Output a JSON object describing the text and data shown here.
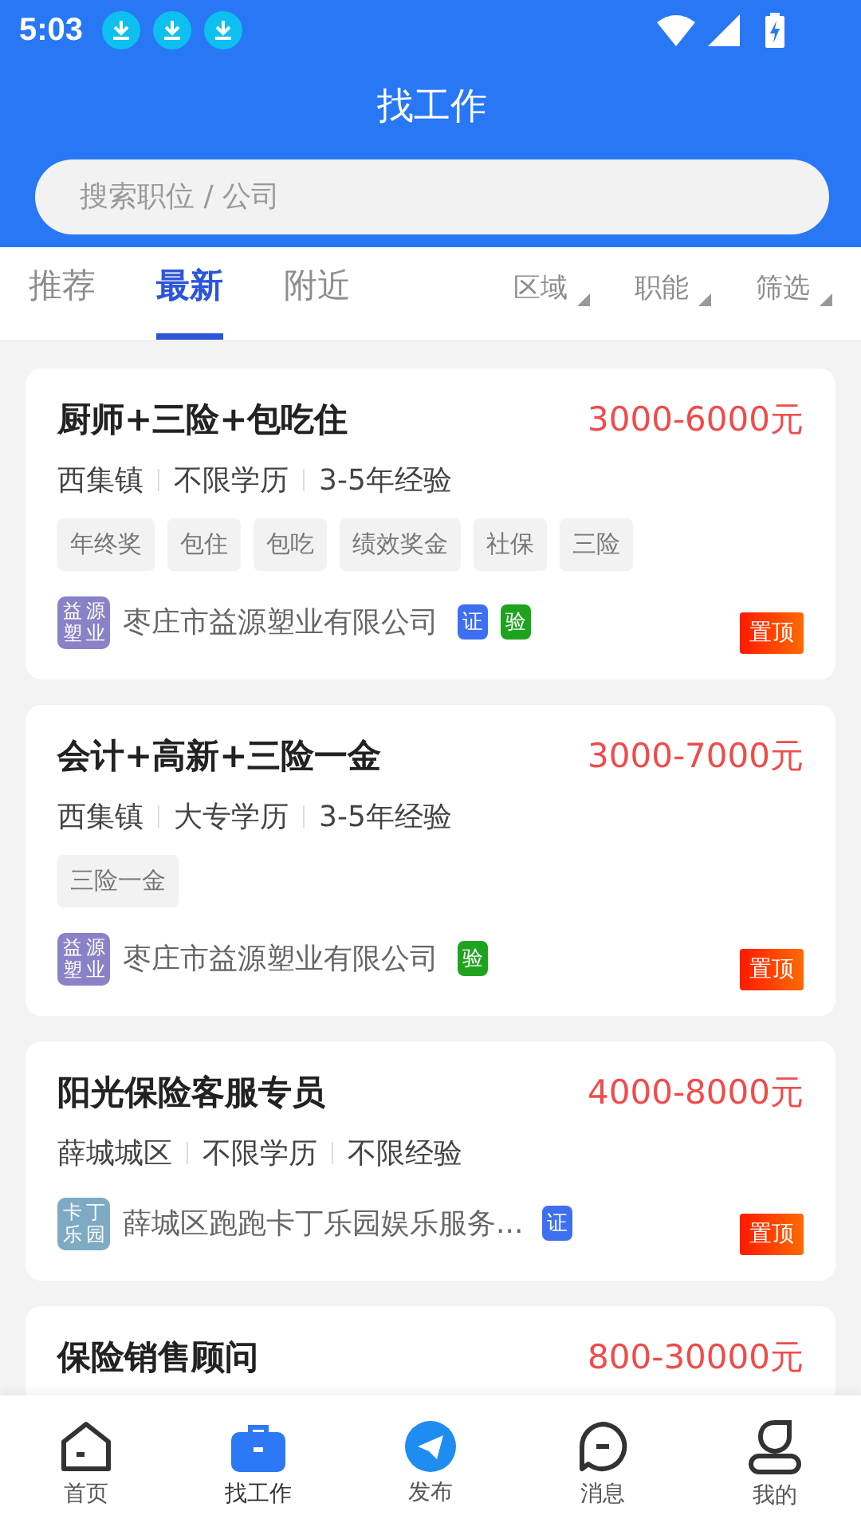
{
  "status_bar": {
    "time": "5:03",
    "notifications": [
      {
        "kind": "download"
      },
      {
        "kind": "download"
      },
      {
        "kind": "download"
      }
    ]
  },
  "header": {
    "title": "找工作"
  },
  "search": {
    "placeholder": "搜索职位 / 公司"
  },
  "tabs": [
    {
      "label": "推荐",
      "selected": false
    },
    {
      "label": "最新",
      "selected": true
    },
    {
      "label": "附近",
      "selected": false
    }
  ],
  "filters": [
    {
      "label": "区域"
    },
    {
      "label": "职能"
    },
    {
      "label": "筛选"
    }
  ],
  "jobs": [
    {
      "title": "厨师+三险+包吃住",
      "salary": "3000-6000元",
      "meta": [
        "西集镇",
        "不限学历",
        "3-5年经验"
      ],
      "tags": [
        "年终奖",
        "包住",
        "包吃",
        "绩效奖金",
        "社保",
        "三险"
      ],
      "logo": {
        "text": "益源塑业",
        "color": "#8a82c6"
      },
      "company": "枣庄市益源塑业有限公司",
      "badges": [
        {
          "label": "证",
          "kind": "cert"
        },
        {
          "label": "验",
          "kind": "verified"
        }
      ],
      "pin": "置顶"
    },
    {
      "title": "会计+高新+三险一金",
      "salary": "3000-7000元",
      "meta": [
        "西集镇",
        "大专学历",
        "3-5年经验"
      ],
      "tags": [
        "三险一金"
      ],
      "logo": {
        "text": "益源塑业",
        "color": "#8a82c6"
      },
      "company": "枣庄市益源塑业有限公司",
      "badges": [
        {
          "label": "验",
          "kind": "verified"
        }
      ],
      "pin": "置顶"
    },
    {
      "title": "阳光保险客服专员",
      "salary": "4000-8000元",
      "meta": [
        "薛城城区",
        "不限学历",
        "不限经验"
      ],
      "logo": {
        "text": "卡丁乐园",
        "color": "#7eaac4"
      },
      "company": "薛城区跑跑卡丁乐园娱乐服务...",
      "badges": [
        {
          "label": "证",
          "kind": "cert"
        }
      ],
      "pin": "置顶"
    },
    {
      "title": "保险销售顾问",
      "salary": "800-30000元"
    }
  ],
  "nav": [
    {
      "label": "首页",
      "kind": "home",
      "selected": false
    },
    {
      "label": "找工作",
      "kind": "jobs",
      "selected": true
    },
    {
      "label": "发布",
      "kind": "post",
      "selected": false
    },
    {
      "label": "消息",
      "kind": "message",
      "selected": false
    },
    {
      "label": "我的",
      "kind": "me",
      "selected": false
    }
  ]
}
